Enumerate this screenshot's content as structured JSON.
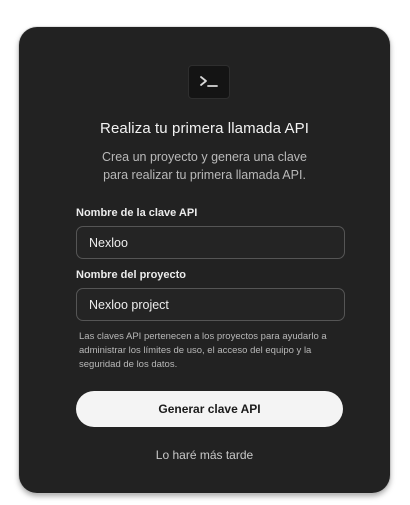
{
  "dialog": {
    "icon": "terminal-icon",
    "title": "Realiza tu primera llamada API",
    "subtitle_line1": "Crea un proyecto y genera una clave",
    "subtitle_line2": "para realizar tu primera llamada API.",
    "api_key_label": "Nombre de la clave API",
    "api_key_value": "Nexloo",
    "project_label": "Nombre del proyecto",
    "project_value": "Nexloo project",
    "help_text": "Las claves API pertenecen a los proyectos para ayudarlo a administrar los límites de uso, el acceso del equipo y la seguridad de los datos.",
    "generate_button": "Generar clave API",
    "later_link": "Lo haré más tarde"
  },
  "colors": {
    "card_background": "#222222",
    "button_background": "#f4f4f4",
    "input_border": "#555555"
  }
}
